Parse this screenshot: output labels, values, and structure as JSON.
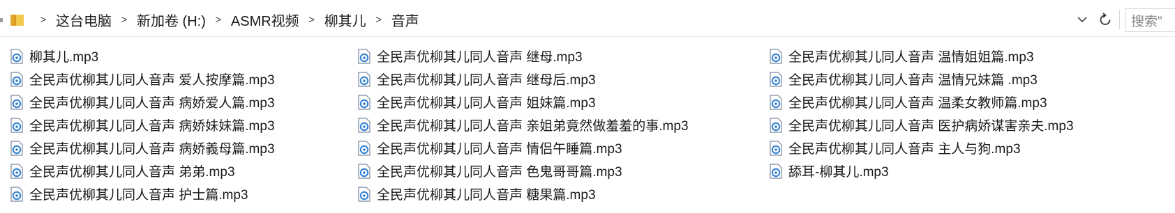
{
  "breadcrumb": {
    "items": [
      "这台电脑",
      "新加卷 (H:)",
      "ASMR视频",
      "柳其儿",
      "音声"
    ],
    "separator": ">"
  },
  "search": {
    "placeholder": "搜索\""
  },
  "colors": {
    "folder": "#f2c94c",
    "file_icon": "#2f7fd1",
    "text": "#1a1a1a",
    "muted": "#8a8a8a",
    "border": "#d9d9d9"
  },
  "icons": {
    "folder": "folder-icon",
    "dropdown": "chevron-down-icon",
    "refresh": "refresh-icon",
    "file": "audio-file-icon"
  },
  "files": {
    "column_1": [
      "柳其儿.mp3",
      "全民声优柳其儿同人音声 爱人按摩篇.mp3",
      "全民声优柳其儿同人音声 病娇爱人篇.mp3",
      "全民声优柳其儿同人音声 病娇妹妹篇.mp3",
      "全民声优柳其儿同人音声 病娇義母篇.mp3",
      "全民声优柳其儿同人音声 弟弟.mp3",
      "全民声优柳其儿同人音声 护士篇.mp3"
    ],
    "column_2": [
      "全民声优柳其儿同人音声 继母.mp3",
      "全民声优柳其儿同人音声 继母后.mp3",
      "全民声优柳其儿同人音声 姐妹篇.mp3",
      "全民声优柳其儿同人音声 亲姐弟竟然做羞羞的事.mp3",
      "全民声优柳其儿同人音声 情侣午睡篇.mp3",
      "全民声优柳其儿同人音声 色鬼哥哥篇.mp3",
      "全民声优柳其儿同人音声 糖果篇.mp3"
    ],
    "column_3": [
      "全民声优柳其儿同人音声 温情姐姐篇.mp3",
      "全民声优柳其儿同人音声 温情兄妹篇 .mp3",
      "全民声优柳其儿同人音声 温柔女教师篇.mp3",
      "全民声优柳其儿同人音声 医护病娇谋害亲夫.mp3",
      "全民声优柳其儿同人音声 主人与狗.mp3",
      "舔耳-柳其儿.mp3"
    ]
  }
}
